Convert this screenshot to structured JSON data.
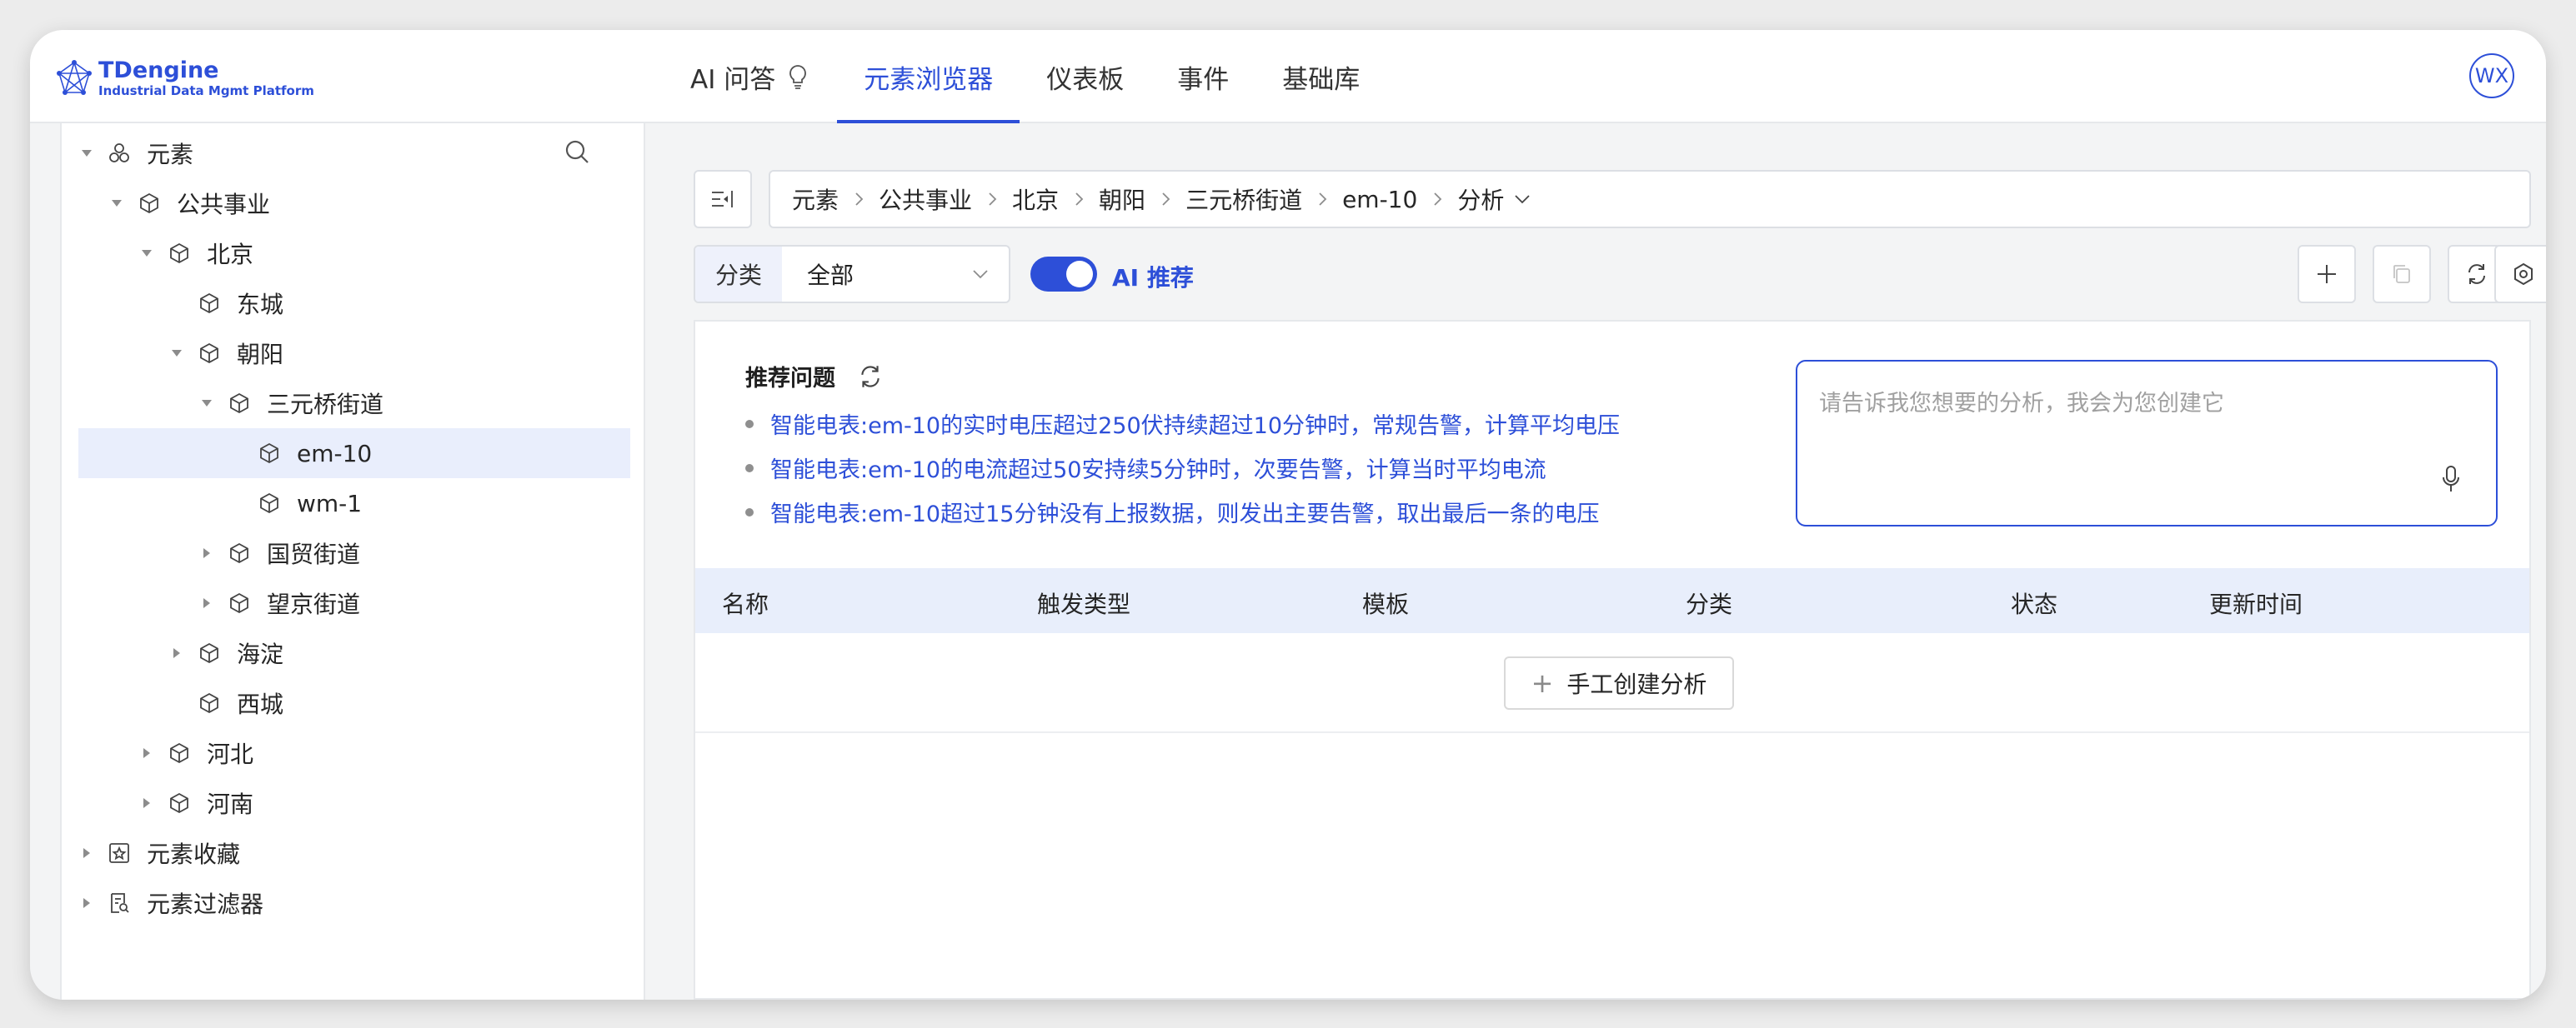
{
  "app": {
    "brand_title": "TDengine",
    "brand_subtitle": "Industrial Data Mgmt Platform",
    "avatar_initials": "WX",
    "accent_color": "#2d4fd8"
  },
  "nav": {
    "tabs": [
      {
        "label": "AI 问答",
        "icon": "lightbulb-icon"
      },
      {
        "label": "元素浏览器",
        "active": true
      },
      {
        "label": "仪表板"
      },
      {
        "label": "事件"
      },
      {
        "label": "基础库"
      }
    ]
  },
  "tree": {
    "items": [
      {
        "label": "元素",
        "expanded": true,
        "icon": "elements-icon"
      },
      {
        "label": "公共事业",
        "expanded": true,
        "icon": "cube-icon"
      },
      {
        "label": "北京",
        "expanded": true,
        "icon": "cube-icon"
      },
      {
        "label": "东城",
        "icon": "cube-icon"
      },
      {
        "label": "朝阳",
        "expanded": true,
        "icon": "cube-icon"
      },
      {
        "label": "三元桥街道",
        "expanded": true,
        "icon": "cube-icon"
      },
      {
        "label": "em-10",
        "selected": true,
        "icon": "cube-icon"
      },
      {
        "label": "wm-1",
        "icon": "cube-icon"
      },
      {
        "label": "国贸街道",
        "expanded": false,
        "icon": "cube-icon"
      },
      {
        "label": "望京街道",
        "expanded": false,
        "icon": "cube-icon"
      },
      {
        "label": "海淀",
        "expanded": false,
        "icon": "cube-icon"
      },
      {
        "label": "西城",
        "icon": "cube-icon"
      },
      {
        "label": "河北",
        "expanded": false,
        "icon": "cube-icon"
      },
      {
        "label": "河南",
        "expanded": false,
        "icon": "cube-icon"
      },
      {
        "label": "元素收藏",
        "expanded": false,
        "icon": "favorites-icon"
      },
      {
        "label": "元素过滤器",
        "expanded": false,
        "icon": "filter-doc-icon"
      }
    ]
  },
  "breadcrumb": {
    "items": [
      "元素",
      "公共事业",
      "北京",
      "朝阳",
      "三元桥街道",
      "em-10",
      "分析"
    ]
  },
  "filter": {
    "label": "分类",
    "value": "全部"
  },
  "ai_toggle": {
    "label": "AI 推荐",
    "on": true
  },
  "recommend": {
    "title": "推荐问题",
    "questions": [
      "智能电表:em-10的实时电压超过250伏持续超过10分钟时，常规告警，计算平均电压",
      "智能电表:em-10的电流超过50安持续5分钟时，次要告警，计算当时平均电流",
      "智能电表:em-10超过15分钟没有上报数据，则发出主要告警，取出最后一条的电压"
    ],
    "input_placeholder": "请告诉我您想要的分析，我会为您创建它"
  },
  "table": {
    "columns": [
      "名称",
      "触发类型",
      "模板",
      "分类",
      "状态",
      "更新时间"
    ],
    "empty_action": "手工创建分析"
  }
}
